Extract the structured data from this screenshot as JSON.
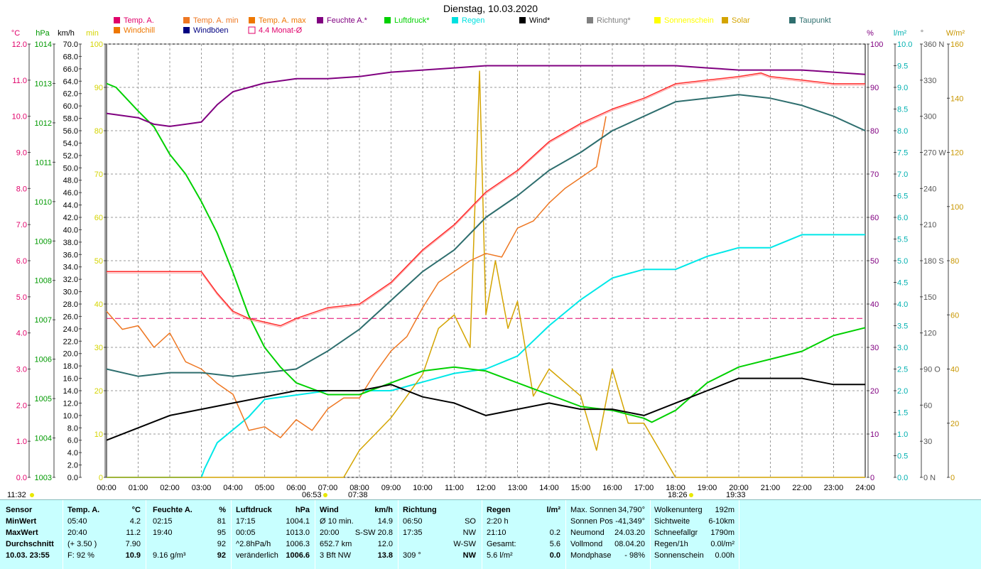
{
  "title": "Dienstag, 10.03.2020",
  "legend": [
    {
      "label": "Temp. A.",
      "color": "#e0006a",
      "kind": "box"
    },
    {
      "label": "Temp. A. min",
      "color": "#ee7722",
      "kind": "box"
    },
    {
      "label": "Temp. A. max",
      "color": "#ee7700",
      "kind": "box"
    },
    {
      "label": "Feuchte A.*",
      "color": "#800080",
      "kind": "box"
    },
    {
      "label": "Luftdruck*",
      "color": "#00d000",
      "kind": "box"
    },
    {
      "label": "Regen",
      "color": "#00e0e0",
      "kind": "box"
    },
    {
      "label": "Wind*",
      "color": "#000000",
      "kind": "box"
    },
    {
      "label": "Richtung*",
      "color": "#808080",
      "kind": "box"
    },
    {
      "label": "Sonnenschein",
      "color": "#ffff00",
      "kind": "box"
    },
    {
      "label": "Solar",
      "color": "#d4a400",
      "kind": "box"
    },
    {
      "label": "Taupunkt",
      "color": "#2e6e6e",
      "kind": "box"
    },
    {
      "label": "Windchill",
      "color": "#ee7700",
      "kind": "box"
    },
    {
      "label": "Windböen",
      "color": "#000080",
      "kind": "box"
    },
    {
      "label": "4.4 Monat-Ø",
      "color": "#e0006a",
      "kind": "outline"
    }
  ],
  "left_units": [
    {
      "text": "°C",
      "color": "#e0006a"
    },
    {
      "text": "hPa",
      "color": "#009900"
    },
    {
      "text": "km/h",
      "color": "#000"
    },
    {
      "text": "min",
      "color": "#d4d400"
    }
  ],
  "right_units": [
    {
      "text": "%",
      "color": "#800080"
    },
    {
      "text": "l/m²",
      "color": "#00b0b0"
    },
    {
      "text": "°",
      "color": "#666"
    },
    {
      "text": "W/m²",
      "color": "#c89600"
    }
  ],
  "footer_marks": {
    "left": "11:32",
    "sunrise": "06:53",
    "sunrise_b": "07:38",
    "sunset": "18:26",
    "sunset_b": "19:33"
  },
  "chart_data": {
    "type": "line",
    "x_ticks": [
      "00:00",
      "01:00",
      "02:00",
      "03:00",
      "04:00",
      "05:00",
      "06:00",
      "07:00",
      "08:00",
      "09:00",
      "10:00",
      "11:00",
      "12:00",
      "13:00",
      "14:00",
      "15:00",
      "16:00",
      "17:00",
      "18:00",
      "19:00",
      "20:00",
      "21:00",
      "22:00",
      "23:00",
      "24:00"
    ],
    "axes": {
      "temp_c": {
        "min": 0.0,
        "max": 12.0,
        "ticks": [
          "0.0",
          "1.0",
          "2.0",
          "3.0",
          "4.0",
          "5.0",
          "6.0",
          "7.0",
          "8.0",
          "9.0",
          "10.0",
          "11.0",
          "12.0"
        ]
      },
      "pressure_hpa": {
        "min": 1003,
        "max": 1014,
        "ticks": [
          "1003",
          "1004",
          "1005",
          "1006",
          "1007",
          "1008",
          "1009",
          "1010",
          "1011",
          "1012",
          "1013",
          "1014"
        ]
      },
      "speed_kmh": {
        "min": 0.0,
        "max": 70.0,
        "ticks": [
          "0.0",
          "2.0",
          "4.0",
          "6.0",
          "8.0",
          "10.0",
          "12.0",
          "14.0",
          "16.0",
          "18.0",
          "20.0",
          "22.0",
          "24.0",
          "26.0",
          "28.0",
          "30.0",
          "32.0",
          "34.0",
          "36.0",
          "38.0",
          "40.0",
          "42.0",
          "44.0",
          "46.0",
          "48.0",
          "50.0",
          "52.0",
          "54.0",
          "56.0",
          "58.0",
          "60.0",
          "62.0",
          "64.0",
          "66.0",
          "68.0",
          "70.0"
        ]
      },
      "minutes": {
        "min": 0,
        "max": 100,
        "ticks": [
          "0",
          "10",
          "20",
          "30",
          "40",
          "50",
          "60",
          "70",
          "80",
          "90",
          "100"
        ]
      },
      "humidity_pct": {
        "min": 0,
        "max": 100,
        "ticks": [
          "0",
          "10",
          "20",
          "30",
          "40",
          "50",
          "60",
          "70",
          "80",
          "90",
          "100"
        ]
      },
      "rain_lm2": {
        "min": 0.0,
        "max": 10.0,
        "ticks": [
          "0.0",
          "0.5",
          "1.0",
          "1.5",
          "2.0",
          "2.5",
          "3.0",
          "3.5",
          "4.0",
          "4.5",
          "5.0",
          "5.5",
          "6.0",
          "6.5",
          "7.0",
          "7.5",
          "8.0",
          "8.5",
          "9.0",
          "9.5",
          "10.0"
        ]
      },
      "direction_deg": {
        "min": 0,
        "max": 360,
        "ticks": [
          "0 N",
          "30",
          "60",
          "90 O",
          "120",
          "150",
          "180 S",
          "210",
          "240",
          "270 W",
          "300",
          "330",
          "360 N"
        ]
      },
      "solar_wm2": {
        "min": 0,
        "max": 160,
        "ticks": [
          "0",
          "20",
          "40",
          "60",
          "80",
          "100",
          "120",
          "140",
          "160"
        ]
      }
    },
    "series": [
      {
        "name": "Temp. A.",
        "unit": "°C",
        "x": [
          0,
          1,
          2,
          3,
          3.5,
          4,
          4.5,
          5,
          5.5,
          6,
          7,
          8,
          9,
          10,
          11,
          12,
          13,
          14,
          15,
          16,
          17,
          18,
          19,
          20,
          20.7,
          21,
          22,
          23,
          24
        ],
        "y": [
          5.7,
          5.7,
          5.7,
          5.7,
          5.1,
          4.6,
          4.4,
          4.3,
          4.2,
          4.4,
          4.7,
          4.8,
          5.4,
          6.3,
          7.0,
          7.9,
          8.5,
          9.3,
          9.8,
          10.2,
          10.5,
          10.9,
          11.0,
          11.1,
          11.2,
          11.1,
          11.0,
          10.9,
          10.9
        ]
      },
      {
        "name": "Temp. A. min",
        "unit": "°C",
        "x": [
          0,
          0.5,
          1,
          1.5,
          2,
          2.5,
          3,
          3.5,
          4,
          4.5,
          5,
          5.5,
          6,
          6.5,
          7,
          7.5,
          8,
          8.5,
          9,
          9.5,
          10,
          10.5,
          11,
          11.5,
          12,
          12.5,
          13,
          13.5,
          14,
          14.5,
          15,
          15.5,
          15.8
        ],
        "y": [
          4.6,
          4.1,
          4.2,
          3.6,
          4.0,
          3.2,
          3.0,
          2.6,
          2.3,
          1.3,
          1.4,
          1.1,
          1.6,
          1.3,
          1.9,
          2.2,
          2.2,
          2.9,
          3.5,
          3.9,
          4.7,
          5.4,
          5.7,
          6.0,
          6.2,
          6.1,
          6.9,
          7.1,
          7.6,
          8.0,
          8.3,
          8.6,
          10.0
        ]
      },
      {
        "name": "Feuchte A.",
        "unit": "%",
        "x": [
          0,
          1,
          1.5,
          2,
          2.5,
          3,
          3.5,
          4,
          4.5,
          5,
          6,
          7,
          8,
          9,
          10,
          11,
          12,
          13,
          14,
          15,
          16,
          17,
          18,
          19,
          20,
          21,
          22,
          23,
          24
        ],
        "y": [
          84,
          83,
          81.5,
          81,
          81.5,
          82,
          86,
          89,
          90,
          91,
          92,
          92,
          92.5,
          93.5,
          94,
          94.5,
          95,
          95,
          95,
          95,
          95,
          95,
          95,
          94.5,
          94,
          94,
          94,
          93.5,
          93
        ]
      },
      {
        "name": "Luftdruck",
        "unit": "hPa",
        "x": [
          0,
          0.3,
          1,
          1.5,
          2,
          2.5,
          3,
          3.5,
          4,
          4.5,
          5,
          5.5,
          6,
          7,
          8,
          9,
          10,
          11,
          12,
          13,
          14,
          15,
          16,
          17,
          17.25,
          18,
          19,
          20,
          21,
          22,
          23,
          24
        ],
        "y": [
          1013.0,
          1012.9,
          1012.3,
          1011.9,
          1011.2,
          1010.7,
          1010.0,
          1009.2,
          1008.2,
          1007.1,
          1006.3,
          1005.8,
          1005.4,
          1005.1,
          1005.1,
          1005.4,
          1005.7,
          1005.8,
          1005.7,
          1005.4,
          1005.1,
          1004.8,
          1004.7,
          1004.5,
          1004.4,
          1004.7,
          1005.4,
          1005.8,
          1006.0,
          1006.2,
          1006.6,
          1006.8
        ]
      },
      {
        "name": "Regen",
        "unit": "l/m²",
        "x": [
          0,
          3.0,
          3.1,
          3.5,
          4.5,
          5.0,
          6.0,
          7.0,
          8.0,
          9.0,
          10.0,
          11.0,
          12.0,
          13.0,
          14.0,
          15.0,
          16.0,
          17.0,
          18.0,
          19.0,
          20.0,
          21.0,
          22.0,
          23.0,
          24.0
        ],
        "y": [
          0.0,
          0.0,
          0.2,
          0.8,
          1.4,
          1.8,
          1.9,
          2.0,
          2.0,
          2.0,
          2.2,
          2.4,
          2.5,
          2.8,
          3.5,
          4.1,
          4.6,
          4.8,
          4.8,
          5.1,
          5.3,
          5.3,
          5.6,
          5.6,
          5.6
        ]
      },
      {
        "name": "Wind",
        "unit": "km/h",
        "x": [
          0,
          1,
          2,
          3,
          4,
          5,
          6,
          7,
          8,
          9,
          10,
          11,
          12,
          13,
          14,
          15,
          16,
          17,
          18,
          19,
          20,
          21,
          22,
          23,
          24
        ],
        "y": [
          6,
          8,
          10,
          11,
          12,
          13,
          14,
          14,
          14,
          15,
          13,
          12,
          10,
          11,
          12,
          11,
          11,
          10,
          12,
          14,
          16,
          16,
          16,
          15,
          15
        ]
      },
      {
        "name": "Taupunkt",
        "unit": "°C",
        "x": [
          0,
          1,
          2,
          3,
          4,
          5,
          6,
          7,
          8,
          9,
          10,
          11,
          12,
          13,
          14,
          15,
          16,
          17,
          18,
          19,
          20,
          21,
          22,
          23,
          24
        ],
        "y": [
          3.0,
          2.8,
          2.9,
          2.9,
          2.8,
          2.9,
          3.0,
          3.5,
          4.1,
          4.9,
          5.7,
          6.3,
          7.2,
          7.8,
          8.5,
          9.0,
          9.6,
          10.0,
          10.4,
          10.5,
          10.6,
          10.5,
          10.3,
          10.0,
          9.6
        ]
      },
      {
        "name": "Solar",
        "unit": "W/m²",
        "x": [
          0,
          7.5,
          8,
          8.5,
          9,
          9.5,
          10,
          10.5,
          11,
          11.5,
          11.8,
          12,
          12.3,
          12.7,
          13,
          13.5,
          14,
          14.5,
          15,
          15.5,
          16,
          16.5,
          17,
          17.5,
          18,
          18.5,
          24
        ],
        "y": [
          0,
          0,
          10,
          16,
          22,
          30,
          38,
          55,
          60,
          48,
          150,
          60,
          80,
          55,
          65,
          30,
          40,
          35,
          30,
          10,
          40,
          20,
          20,
          10,
          0,
          0,
          0
        ]
      },
      {
        "name": "4.4 Monat-Ø",
        "unit": "°C",
        "x": [
          0,
          24
        ],
        "y": [
          4.4,
          4.4
        ]
      }
    ]
  },
  "stats": {
    "col_sensor": {
      "header": "Sensor",
      "rows": [
        "MinWert",
        "MaxWert",
        "Durchschnitt",
        "10.03. 23:55"
      ]
    },
    "col_temp": {
      "header": "Temp. A.",
      "unit": "°C",
      "rows": [
        [
          "05:40",
          "4.2"
        ],
        [
          "20:40",
          "11.2"
        ],
        [
          "(+ 3.50 )",
          "7.90"
        ],
        [
          "F: 92 %",
          "10.9"
        ]
      ]
    },
    "col_hum": {
      "header": "Feuchte A.",
      "unit": "%",
      "rows": [
        [
          "02:15",
          "81"
        ],
        [
          "19:40",
          "95"
        ],
        [
          "",
          "92"
        ],
        [
          "9.16 g/m³",
          "92"
        ]
      ]
    },
    "col_press": {
      "header": "Luftdruck",
      "unit": "hPa",
      "rows": [
        [
          "17:15",
          "1004.1"
        ],
        [
          "00:05",
          "1013.0"
        ],
        [
          "^2.8hPa/h",
          "1006.3"
        ],
        [
          "veränderlich",
          "1006.6"
        ]
      ]
    },
    "col_wind": {
      "header": "Wind",
      "unit": "km/h",
      "rows": [
        [
          "Ø 10 min.",
          "14.9"
        ],
        [
          "20:00",
          "S-SW 20.8"
        ],
        [
          "652.7 km",
          "12.0"
        ],
        [
          "3 Bft NW",
          "13.8"
        ]
      ]
    },
    "col_dir": {
      "header": "Richtung",
      "rows": [
        [
          "06:50",
          "SO"
        ],
        [
          "17:35",
          "NW"
        ],
        [
          "",
          "W-SW"
        ],
        [
          "309 °",
          "NW"
        ]
      ]
    },
    "col_rain": {
      "header": "Regen",
      "unit": "l/m²",
      "rows": [
        [
          "2:20 h",
          ""
        ],
        [
          "21:10",
          "0.2"
        ],
        [
          "Gesamt:",
          "5.6"
        ],
        [
          "5.6 l/m²",
          "0.0"
        ]
      ]
    },
    "col_astro": {
      "rows": [
        [
          "Max. Sonnen",
          "34,790°"
        ],
        [
          "Sonnen Pos",
          "-41,349°"
        ],
        [
          "Neumond",
          "24.03.20"
        ],
        [
          "Vollmond",
          "08.04.20"
        ],
        [
          "Mondphase",
          "- 98%"
        ]
      ]
    },
    "col_misc": {
      "rows": [
        [
          "Wolkenunterg",
          "192m"
        ],
        [
          "Sichtweite",
          "6-10km"
        ],
        [
          "Schneefallgr",
          "1790m"
        ],
        [
          "Regen/1h",
          "0.0l/m²"
        ],
        [
          "Sonnenschein",
          "0.00h"
        ]
      ]
    }
  }
}
